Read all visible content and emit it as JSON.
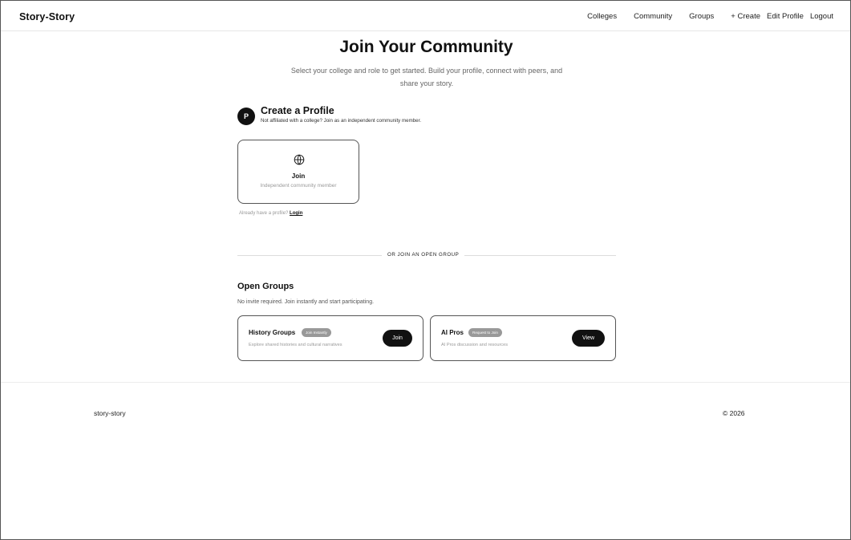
{
  "nav": {
    "brand": "Story-Story",
    "links": [
      "Colleges",
      "Community",
      "Groups",
      "+ Create",
      "Edit Profile",
      "Logout"
    ]
  },
  "hero": {
    "title": "Join Your Community",
    "subtitle": "Select your college and role to get started. Build your profile, connect with peers, and share your story."
  },
  "create_profile": {
    "badge_letter": "P",
    "title": "Create a Profile",
    "subtitle": "Not affiliated with a college? Join as an independent community member.",
    "card": {
      "icon": "globe-icon",
      "title": "Join",
      "subtitle": "Independent community member"
    },
    "already_text": "Already have a profile?",
    "login_link": "Login"
  },
  "divider_label": "OR JOIN AN OPEN GROUP",
  "open_groups": {
    "title": "Open Groups",
    "subtitle": "No invite required. Join instantly and start participating.",
    "groups": [
      {
        "name": "History Groups",
        "badge": "Join Instantly",
        "description": "Explore shared histories and cultural narratives",
        "button": "Join"
      },
      {
        "name": "AI Pros",
        "badge": "Request to Join",
        "description": "AI Pros discussion and resources",
        "button": "View"
      }
    ]
  },
  "footer": {
    "left": "story-story",
    "right": "© 2026"
  },
  "colors": {
    "accent": "#111111",
    "badge": "#999999",
    "border": "#555555",
    "muted_text": "#999999"
  }
}
